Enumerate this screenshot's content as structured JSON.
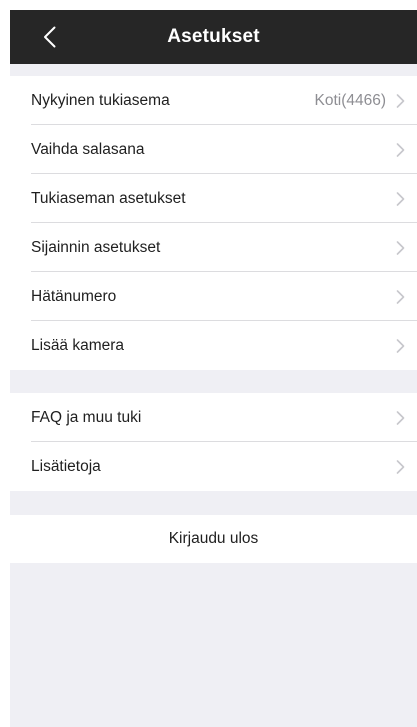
{
  "header": {
    "title": "Asetukset",
    "back_icon": "chevron-left-icon"
  },
  "groups": [
    {
      "items": [
        {
          "label": "Nykyinen tukiasema",
          "value": "Koti(4466)"
        },
        {
          "label": "Vaihda salasana"
        },
        {
          "label": "Tukiaseman asetukset"
        },
        {
          "label": "Sijainnin asetukset"
        },
        {
          "label": "Hätänumero"
        },
        {
          "label": "Lisää kamera"
        }
      ]
    },
    {
      "items": [
        {
          "label": "FAQ ja muu tuki"
        },
        {
          "label": "Lisätietoja"
        }
      ]
    }
  ],
  "logout_label": "Kirjaudu ulos",
  "colors": {
    "navbar": "#262626",
    "background": "#efeff4",
    "text": "#1f1f1f",
    "secondary_text": "#8e8e93",
    "separator": "#dcdcdf"
  }
}
